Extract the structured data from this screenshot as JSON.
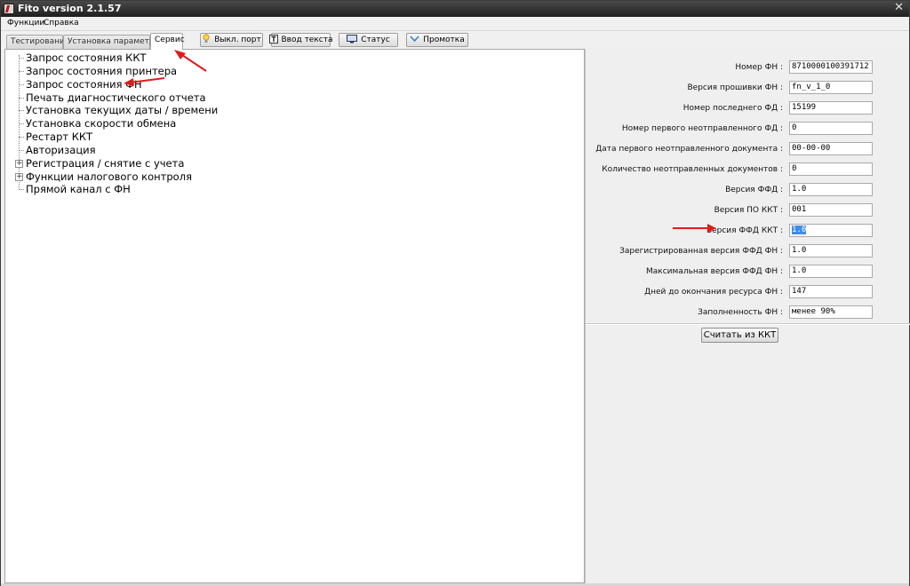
{
  "window": {
    "title": "Fito version 2.1.57",
    "close_glyph": "✕"
  },
  "menubar": {
    "items": [
      "Функции",
      "Справка"
    ]
  },
  "tabs": [
    {
      "label": "Тестирование",
      "active": false
    },
    {
      "label": "Установка параметров",
      "active": false
    },
    {
      "label": "Сервис",
      "active": true
    }
  ],
  "toolbar": {
    "buttons": [
      {
        "label": "Выкл. порт",
        "icon": "bulb-icon"
      },
      {
        "label": "Ввод текста",
        "icon": "text-input-icon"
      },
      {
        "label": "Статус",
        "icon": "monitor-icon"
      },
      {
        "label": "Промотка",
        "icon": "chevron-down-icon"
      }
    ]
  },
  "tree": {
    "items": [
      {
        "label": "Запрос состояния ККТ",
        "expandable": false
      },
      {
        "label": "Запрос состояния принтера",
        "expandable": false
      },
      {
        "label": "Запрос состояния ФН",
        "expandable": false
      },
      {
        "label": "Печать диагностического отчета",
        "expandable": false
      },
      {
        "label": "Установка текущих даты / времени",
        "expandable": false
      },
      {
        "label": "Установка скорости обмена",
        "expandable": false
      },
      {
        "label": "Рестарт ККТ",
        "expandable": false
      },
      {
        "label": "Авторизация",
        "expandable": false
      },
      {
        "label": "Регистрация / снятие с учета",
        "expandable": true
      },
      {
        "label": "Функции налогового контроля",
        "expandable": true
      },
      {
        "label": "Прямой канал с ФН",
        "expandable": false
      }
    ],
    "expander_glyph": "+"
  },
  "fn_info": {
    "fields": [
      {
        "label": "Номер ФН :",
        "value": "8710000100391712"
      },
      {
        "label": "Версия прошивки ФН :",
        "value": "fn_v_1_0"
      },
      {
        "label": "Номер последнего ФД :",
        "value": "15199"
      },
      {
        "label": "Номер первого неотправленного ФД :",
        "value": "0"
      },
      {
        "label": "Дата первого неотправленного документа :",
        "value": "00-00-00"
      },
      {
        "label": "Количество неотправленных документов :",
        "value": "0"
      },
      {
        "label": "Версия ФФД :",
        "value": "1.0"
      },
      {
        "label": "Версия ПО ККТ :",
        "value": "001"
      },
      {
        "label": "Версия ФФД ККТ :",
        "value": "1.0",
        "selected": true
      },
      {
        "label": "Зарегистрированная версия ФФД ФН :",
        "value": "1.0"
      },
      {
        "label": "Максимальная версия ФФД ФН :",
        "value": "1.0"
      },
      {
        "label": "Дней до окончания ресурса ФН :",
        "value": "147"
      },
      {
        "label": "Заполненность ФН :",
        "value": "менее 90%"
      }
    ],
    "read_button_label": "Считать из ККТ"
  },
  "colors": {
    "annotation_arrow": "#e01b1b",
    "selection": "#3f8ce8"
  }
}
